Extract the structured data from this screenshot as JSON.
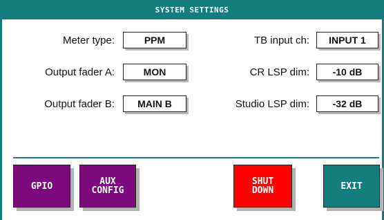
{
  "title": "SYSTEM SETTINGS",
  "left_settings": [
    {
      "label": "Meter type:",
      "value": "PPM"
    },
    {
      "label": "Output fader A:",
      "value": "MON"
    },
    {
      "label": "Output fader B:",
      "value": "MAIN B"
    }
  ],
  "right_settings": [
    {
      "label": "TB input ch:",
      "value": "INPUT 1"
    },
    {
      "label": "CR LSP dim:",
      "value": "-10 dB"
    },
    {
      "label": "Studio LSP dim:",
      "value": "-32 dB"
    }
  ],
  "buttons": {
    "gpio": {
      "label": "GPIO",
      "color": "#7d0a7d"
    },
    "aux_config": {
      "line1": "AUX",
      "line2": "CONFIG",
      "color": "#7d0a7d"
    },
    "shut_down": {
      "line1": "SHUT",
      "line2": "DOWN",
      "color": "#ff0000"
    },
    "exit": {
      "label": "EXIT",
      "color": "#147d7d"
    }
  },
  "colors": {
    "accent": "#147d7d",
    "purple": "#7d0a7d",
    "red": "#ff0000"
  }
}
